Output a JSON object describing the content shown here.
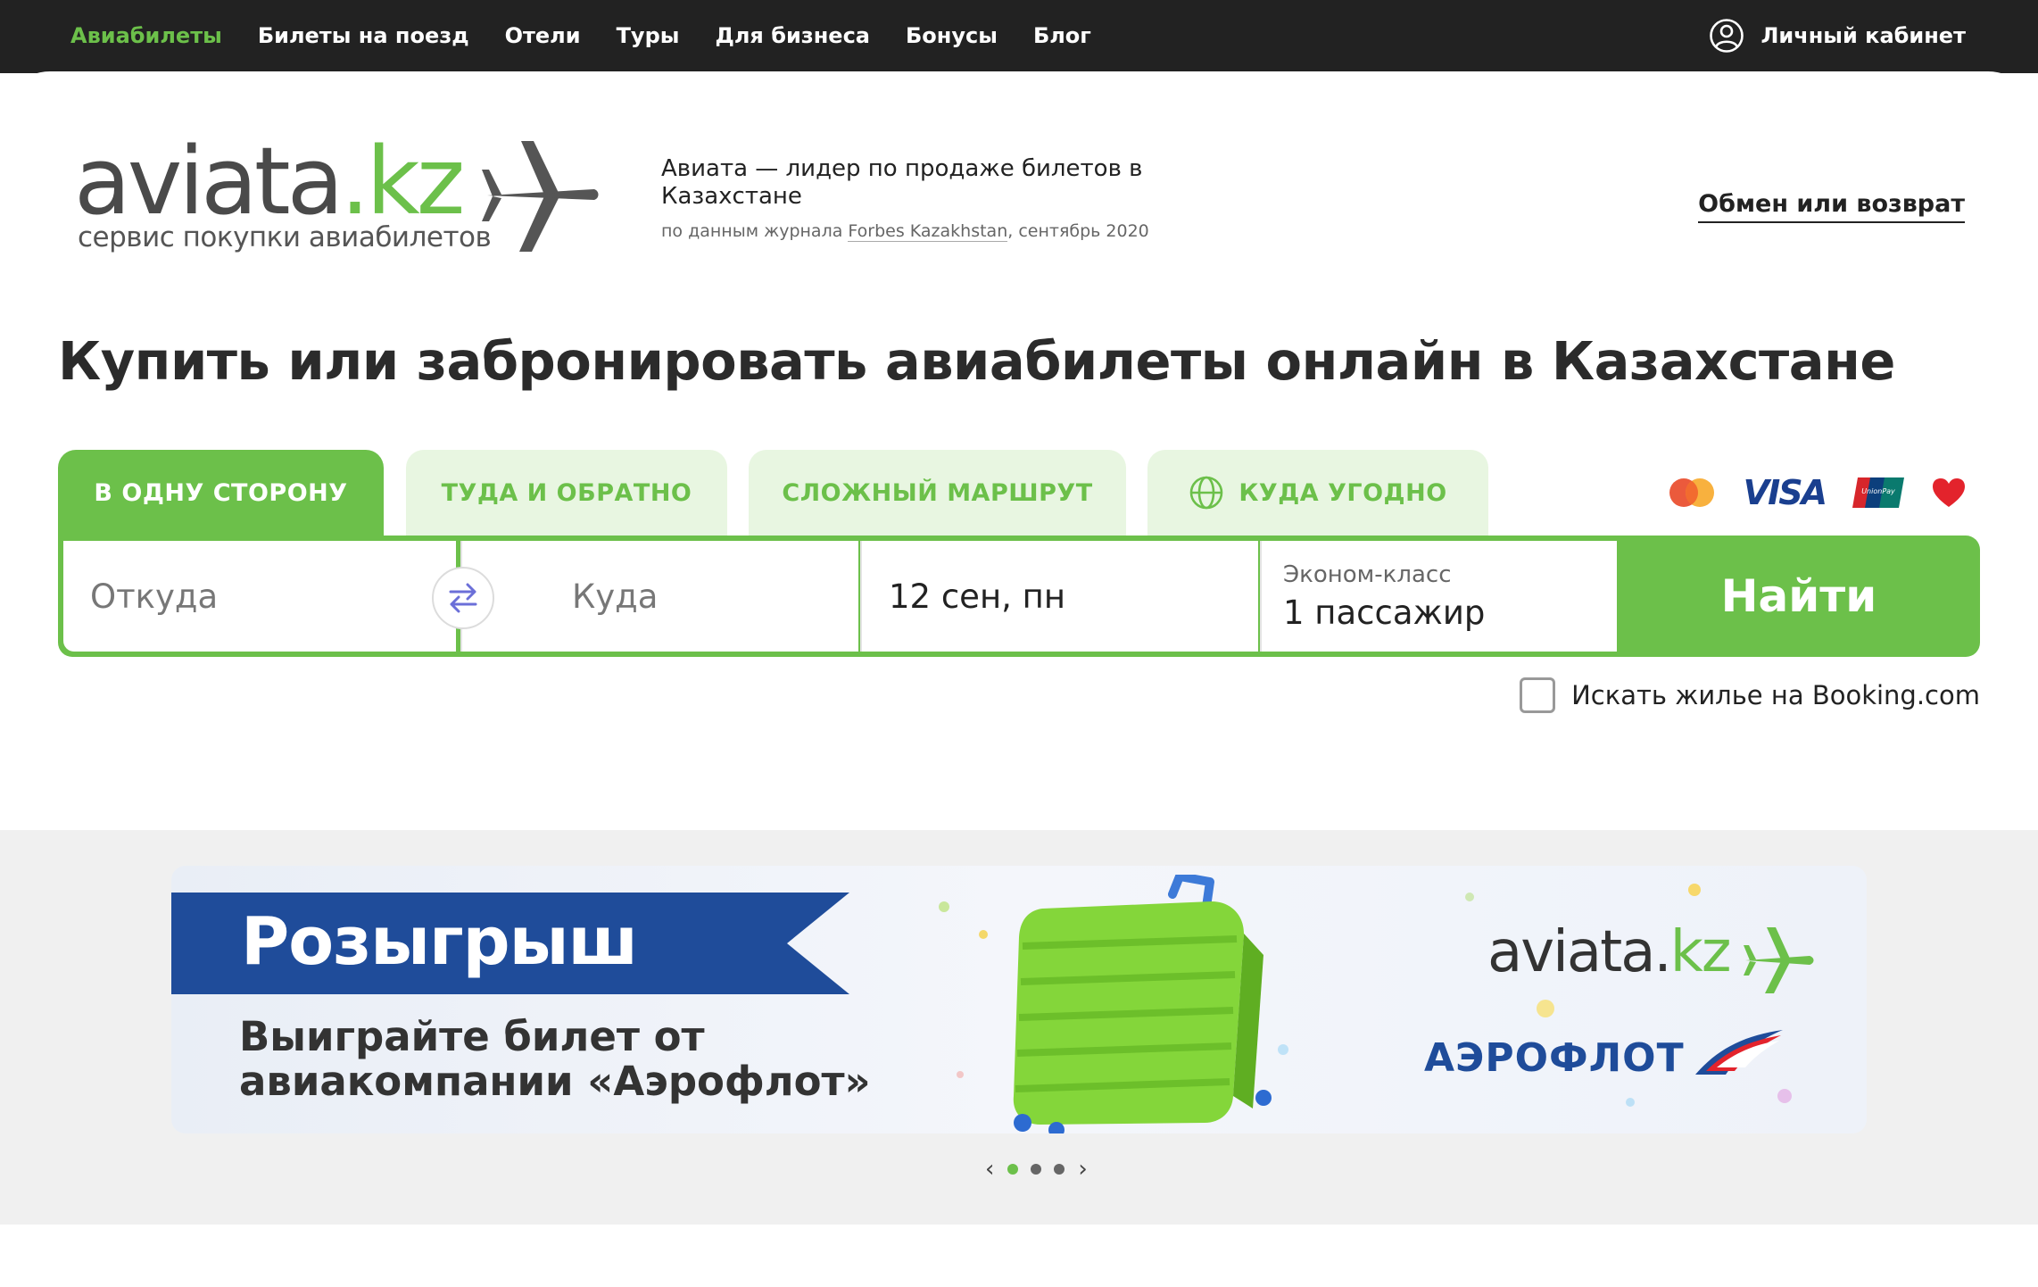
{
  "nav": {
    "items": [
      {
        "label": "Авиабилеты",
        "active": true
      },
      {
        "label": "Билеты на поезд"
      },
      {
        "label": "Отели"
      },
      {
        "label": "Туры"
      },
      {
        "label": "Для бизнеса"
      },
      {
        "label": "Бонусы"
      },
      {
        "label": "Блог"
      }
    ],
    "account_label": "Личный кабинет",
    "account_icon": "user-circle-icon"
  },
  "header": {
    "logo_name": "aviata",
    "logo_dot": ".",
    "logo_tld": "kz",
    "logo_tagline": "сервис покупки авиабилетов",
    "lead_text": "Авиата — лидер по продаже билетов в Казахстане",
    "lead_source_prefix": "по данным журнала ",
    "lead_source_ref": "Forbes Kazakhstan",
    "lead_source_suffix": ", сентябрь 2020",
    "exchange_link": "Обмен или возврат"
  },
  "page_title": "Купить или забронировать авиабилеты онлайн в Казахстане",
  "tabs": [
    {
      "label": "В ОДНУ СТОРОНУ",
      "active": true
    },
    {
      "label": "ТУДА И ОБРАТНО"
    },
    {
      "label": "СЛОЖНЫЙ МАРШРУТ"
    },
    {
      "label": "КУДА УГОДНО",
      "icon": "globe-icon"
    }
  ],
  "payment": {
    "visa_label": "VISA",
    "unionpay_label": "UnionPay",
    "icons": [
      "mastercard-icon",
      "visa-icon",
      "unionpay-icon",
      "heart-icon"
    ]
  },
  "search": {
    "from_placeholder": "Откуда",
    "to_placeholder": "Куда",
    "date_value": "12 сен, пн",
    "class_label": "Эконом-класс",
    "passengers_value": "1 пассажир",
    "find_button": "Найти"
  },
  "booking_checkbox": {
    "label": "Искать жилье на Booking.com",
    "checked": false
  },
  "promo": {
    "title": "Розыгрыш",
    "subtitle_line1": "Выиграйте билет от",
    "subtitle_line2": "авиакомпании «Аэрофлот»",
    "logo_name": "aviata.",
    "logo_tld": "kz",
    "partner": "АЭРОФЛОТ",
    "slides_total": 3,
    "slide_active": 1
  },
  "colors": {
    "accent": "#6cc04a",
    "accent_light": "#e8f6e1",
    "nav_bg": "#222222",
    "promo_blue": "#1f4c9a"
  }
}
